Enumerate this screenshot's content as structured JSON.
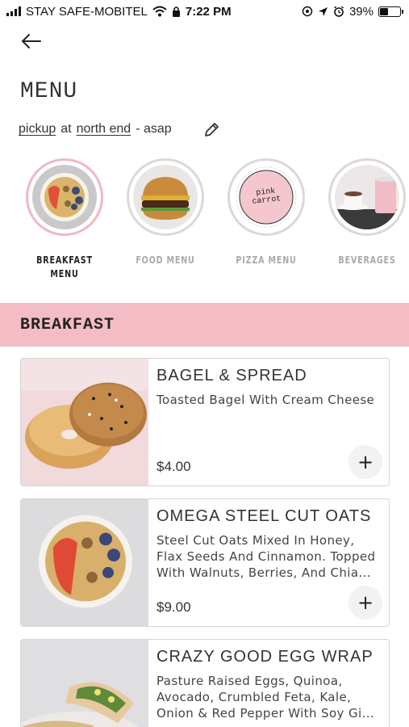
{
  "status_bar": {
    "carrier": "STAY SAFE-MOBITEL",
    "time": "7:22 PM",
    "battery_percent": "39%",
    "battery_level": 0.39
  },
  "header": {
    "back_icon": "back-arrow-icon",
    "title": "MENU"
  },
  "order": {
    "mode": "pickup",
    "at": "at",
    "location": "north end",
    "timing": "- asap",
    "edit_icon": "pencil-icon"
  },
  "categories": [
    {
      "label": "BREAKFAST MENU",
      "active": true
    },
    {
      "label": "FOOD MENU",
      "active": false
    },
    {
      "label": "PIZZA MENU",
      "active": false
    },
    {
      "label": "BEVERAGES",
      "active": false
    }
  ],
  "section": {
    "title": "BREAKFAST",
    "color": "#f4bcc4"
  },
  "items": [
    {
      "name": "BAGEL & SPREAD",
      "description": "Toasted Bagel With Cream Cheese",
      "price": "$4.00",
      "add_label": "+"
    },
    {
      "name": "OMEGA STEEL CUT OATS",
      "description": "Steel Cut Oats Mixed In Honey, Flax Seeds And Cinnamon. Topped With Walnuts, Berries, And Chia...",
      "price": "$9.00",
      "add_label": "+"
    },
    {
      "name": "CRAZY GOOD EGG WRAP",
      "description": "Pasture Raised Eggs, Quinoa, Avocado, Crumbled Feta, Kale, Onion & Red Pepper With Soy Gi...",
      "price": "",
      "add_label": "+"
    }
  ],
  "logo": {
    "text": "pink carrot"
  }
}
